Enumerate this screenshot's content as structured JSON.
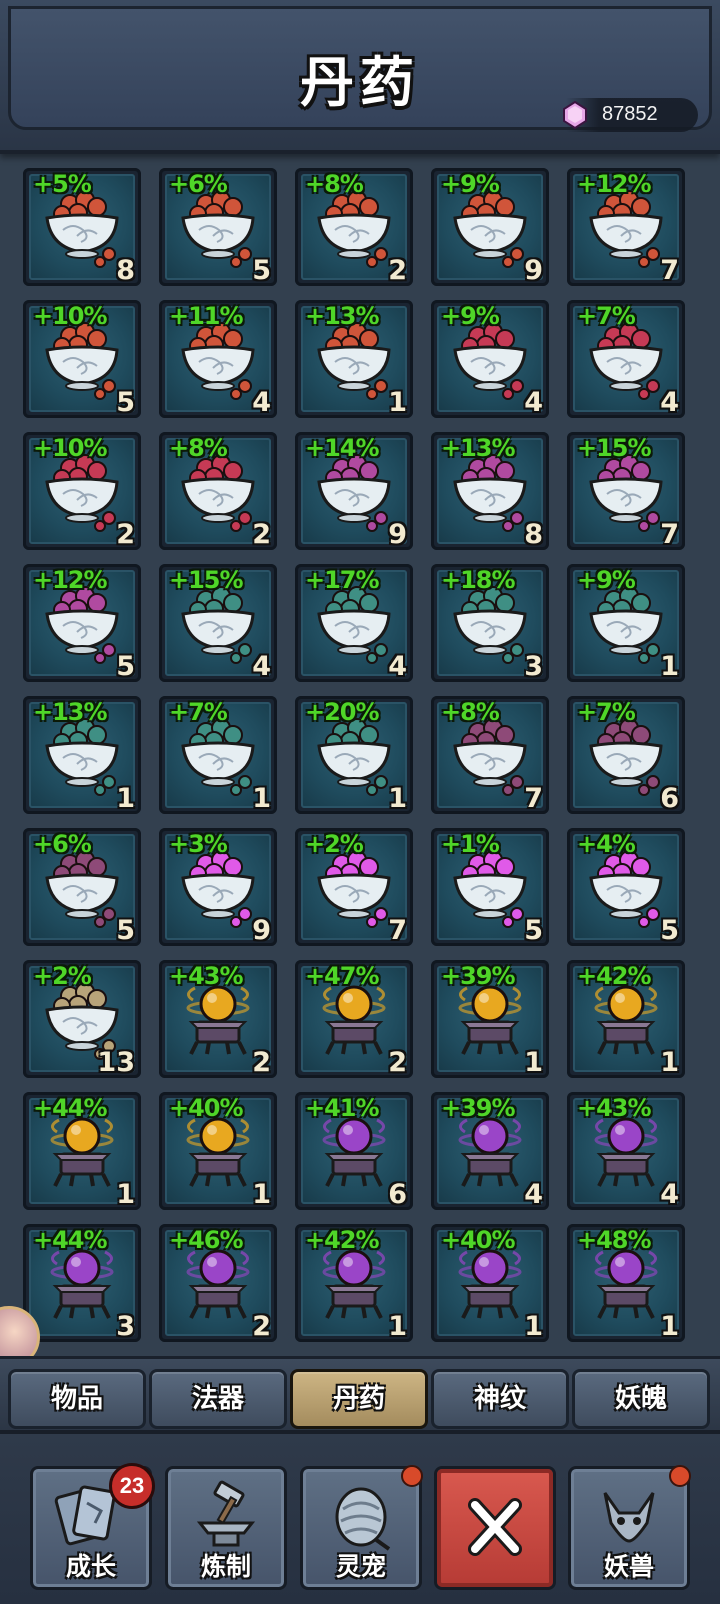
{
  "header": {
    "title": "丹药",
    "currency": {
      "icon": "purple-gem-icon",
      "value": "87852"
    }
  },
  "items": [
    {
      "bonus": "+5%",
      "count": "8",
      "type": "bowl",
      "pill": "#d0553a"
    },
    {
      "bonus": "+6%",
      "count": "5",
      "type": "bowl",
      "pill": "#d0553a"
    },
    {
      "bonus": "+8%",
      "count": "2",
      "type": "bowl",
      "pill": "#d0553a"
    },
    {
      "bonus": "+9%",
      "count": "9",
      "type": "bowl",
      "pill": "#d0553a"
    },
    {
      "bonus": "+12%",
      "count": "7",
      "type": "bowl",
      "pill": "#d0553a"
    },
    {
      "bonus": "+10%",
      "count": "5",
      "type": "bowl",
      "pill": "#d0553a"
    },
    {
      "bonus": "+11%",
      "count": "4",
      "type": "bowl",
      "pill": "#d0553a"
    },
    {
      "bonus": "+13%",
      "count": "1",
      "type": "bowl",
      "pill": "#d0553a"
    },
    {
      "bonus": "+9%",
      "count": "4",
      "type": "bowl",
      "pill": "#c63a55"
    },
    {
      "bonus": "+7%",
      "count": "4",
      "type": "bowl",
      "pill": "#c63a55"
    },
    {
      "bonus": "+10%",
      "count": "2",
      "type": "bowl",
      "pill": "#c63a55"
    },
    {
      "bonus": "+8%",
      "count": "2",
      "type": "bowl",
      "pill": "#c63a55"
    },
    {
      "bonus": "+14%",
      "count": "9",
      "type": "bowl",
      "pill": "#b04aa0"
    },
    {
      "bonus": "+13%",
      "count": "8",
      "type": "bowl",
      "pill": "#b04aa0"
    },
    {
      "bonus": "+15%",
      "count": "7",
      "type": "bowl",
      "pill": "#b04aa0"
    },
    {
      "bonus": "+12%",
      "count": "5",
      "type": "bowl",
      "pill": "#b04aa0"
    },
    {
      "bonus": "+15%",
      "count": "4",
      "type": "bowl",
      "pill": "#3f8f84"
    },
    {
      "bonus": "+17%",
      "count": "4",
      "type": "bowl",
      "pill": "#3f8f84"
    },
    {
      "bonus": "+18%",
      "count": "3",
      "type": "bowl",
      "pill": "#3f8f84"
    },
    {
      "bonus": "+9%",
      "count": "1",
      "type": "bowl",
      "pill": "#3f8f84"
    },
    {
      "bonus": "+13%",
      "count": "1",
      "type": "bowl",
      "pill": "#3f8f84"
    },
    {
      "bonus": "+7%",
      "count": "1",
      "type": "bowl",
      "pill": "#3f8f84"
    },
    {
      "bonus": "+20%",
      "count": "1",
      "type": "bowl",
      "pill": "#3f8f84"
    },
    {
      "bonus": "+8%",
      "count": "7",
      "type": "bowl",
      "pill": "#8e4a78"
    },
    {
      "bonus": "+7%",
      "count": "6",
      "type": "bowl",
      "pill": "#8e4a78"
    },
    {
      "bonus": "+6%",
      "count": "5",
      "type": "bowl",
      "pill": "#8e4a78"
    },
    {
      "bonus": "+3%",
      "count": "9",
      "type": "bowl",
      "pill": "#e05ae8"
    },
    {
      "bonus": "+2%",
      "count": "7",
      "type": "bowl",
      "pill": "#e05ae8"
    },
    {
      "bonus": "+1%",
      "count": "5",
      "type": "bowl",
      "pill": "#e05ae8"
    },
    {
      "bonus": "+4%",
      "count": "5",
      "type": "bowl",
      "pill": "#e05ae8"
    },
    {
      "bonus": "+2%",
      "count": "13",
      "type": "bowl",
      "pill": "#b8a47a"
    },
    {
      "bonus": "+43%",
      "count": "2",
      "type": "orb",
      "pill": "#e8a820"
    },
    {
      "bonus": "+47%",
      "count": "2",
      "type": "orb",
      "pill": "#e8a820"
    },
    {
      "bonus": "+39%",
      "count": "1",
      "type": "orb",
      "pill": "#e8a820"
    },
    {
      "bonus": "+42%",
      "count": "1",
      "type": "orb",
      "pill": "#e8a820"
    },
    {
      "bonus": "+44%",
      "count": "1",
      "type": "orb",
      "pill": "#e8a820"
    },
    {
      "bonus": "+40%",
      "count": "1",
      "type": "orb",
      "pill": "#e8a820"
    },
    {
      "bonus": "+41%",
      "count": "6",
      "type": "orb",
      "pill": "#9a45c8"
    },
    {
      "bonus": "+39%",
      "count": "4",
      "type": "orb",
      "pill": "#9a45c8"
    },
    {
      "bonus": "+43%",
      "count": "4",
      "type": "orb",
      "pill": "#9a45c8"
    },
    {
      "bonus": "+44%",
      "count": "3",
      "type": "orb",
      "pill": "#9a45c8"
    },
    {
      "bonus": "+46%",
      "count": "2",
      "type": "orb",
      "pill": "#9a45c8"
    },
    {
      "bonus": "+42%",
      "count": "1",
      "type": "orb",
      "pill": "#9a45c8"
    },
    {
      "bonus": "+40%",
      "count": "1",
      "type": "orb",
      "pill": "#9a45c8"
    },
    {
      "bonus": "+48%",
      "count": "1",
      "type": "orb",
      "pill": "#9a45c8"
    }
  ],
  "tabs": [
    {
      "label": "物品",
      "active": false
    },
    {
      "label": "法器",
      "active": false
    },
    {
      "label": "丹药",
      "active": true
    },
    {
      "label": "神纹",
      "active": false
    },
    {
      "label": "妖魄",
      "active": false
    }
  ],
  "nav": [
    {
      "label": "成长",
      "icon": "cards-icon",
      "badge": "23"
    },
    {
      "label": "炼制",
      "icon": "anvil-hammer-icon",
      "dot": false
    },
    {
      "label": "灵宠",
      "icon": "pet-egg-icon",
      "dot": true
    },
    {
      "label": "",
      "icon": "close-icon",
      "close": true
    },
    {
      "label": "妖兽",
      "icon": "fox-beast-icon",
      "dot": true
    }
  ]
}
